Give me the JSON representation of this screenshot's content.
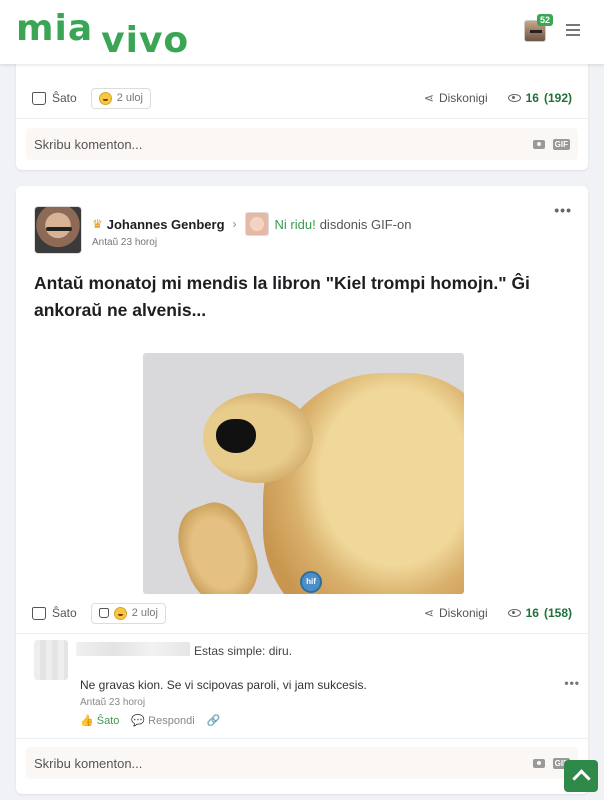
{
  "brand": {
    "logo_a": "mia",
    "logo_b": "vivo",
    "accent": "#3aa655"
  },
  "header": {
    "notification_count": "52"
  },
  "post_prev": {
    "like_label": "Ŝato",
    "reactions_label": "2 uloj",
    "share_label": "Diskonigi",
    "views": "16",
    "views_total": "(192)",
    "comment_placeholder": "Skribu komenton...",
    "gif_label": "GIF"
  },
  "post": {
    "author": "Johannes Genberg",
    "reaction_text": "Ni ridu!",
    "action_text": "disdonis GIF-on",
    "time": "Antaŭ 23 horoj",
    "title": "Antaŭ monatoj mi mendis la libron \"Kiel trompi homojn.\" Ĝi ankoraŭ ne alvenis...",
    "tag_label": "hif",
    "like_label": "Ŝato",
    "reactions_label": "2 uloj",
    "share_label": "Diskonigi",
    "views": "16",
    "views_total": "(158)",
    "comment": {
      "header_text": "Estas simple: diru.",
      "body": "Ne gravas kion. Se vi scipovas paroli, vi jam sukcesis.",
      "time": "Antaŭ 23 horoj",
      "like_label": "Ŝato",
      "reply_label": "Respondi"
    },
    "comment_placeholder": "Skribu komenton...",
    "gif_label": "GIF"
  }
}
